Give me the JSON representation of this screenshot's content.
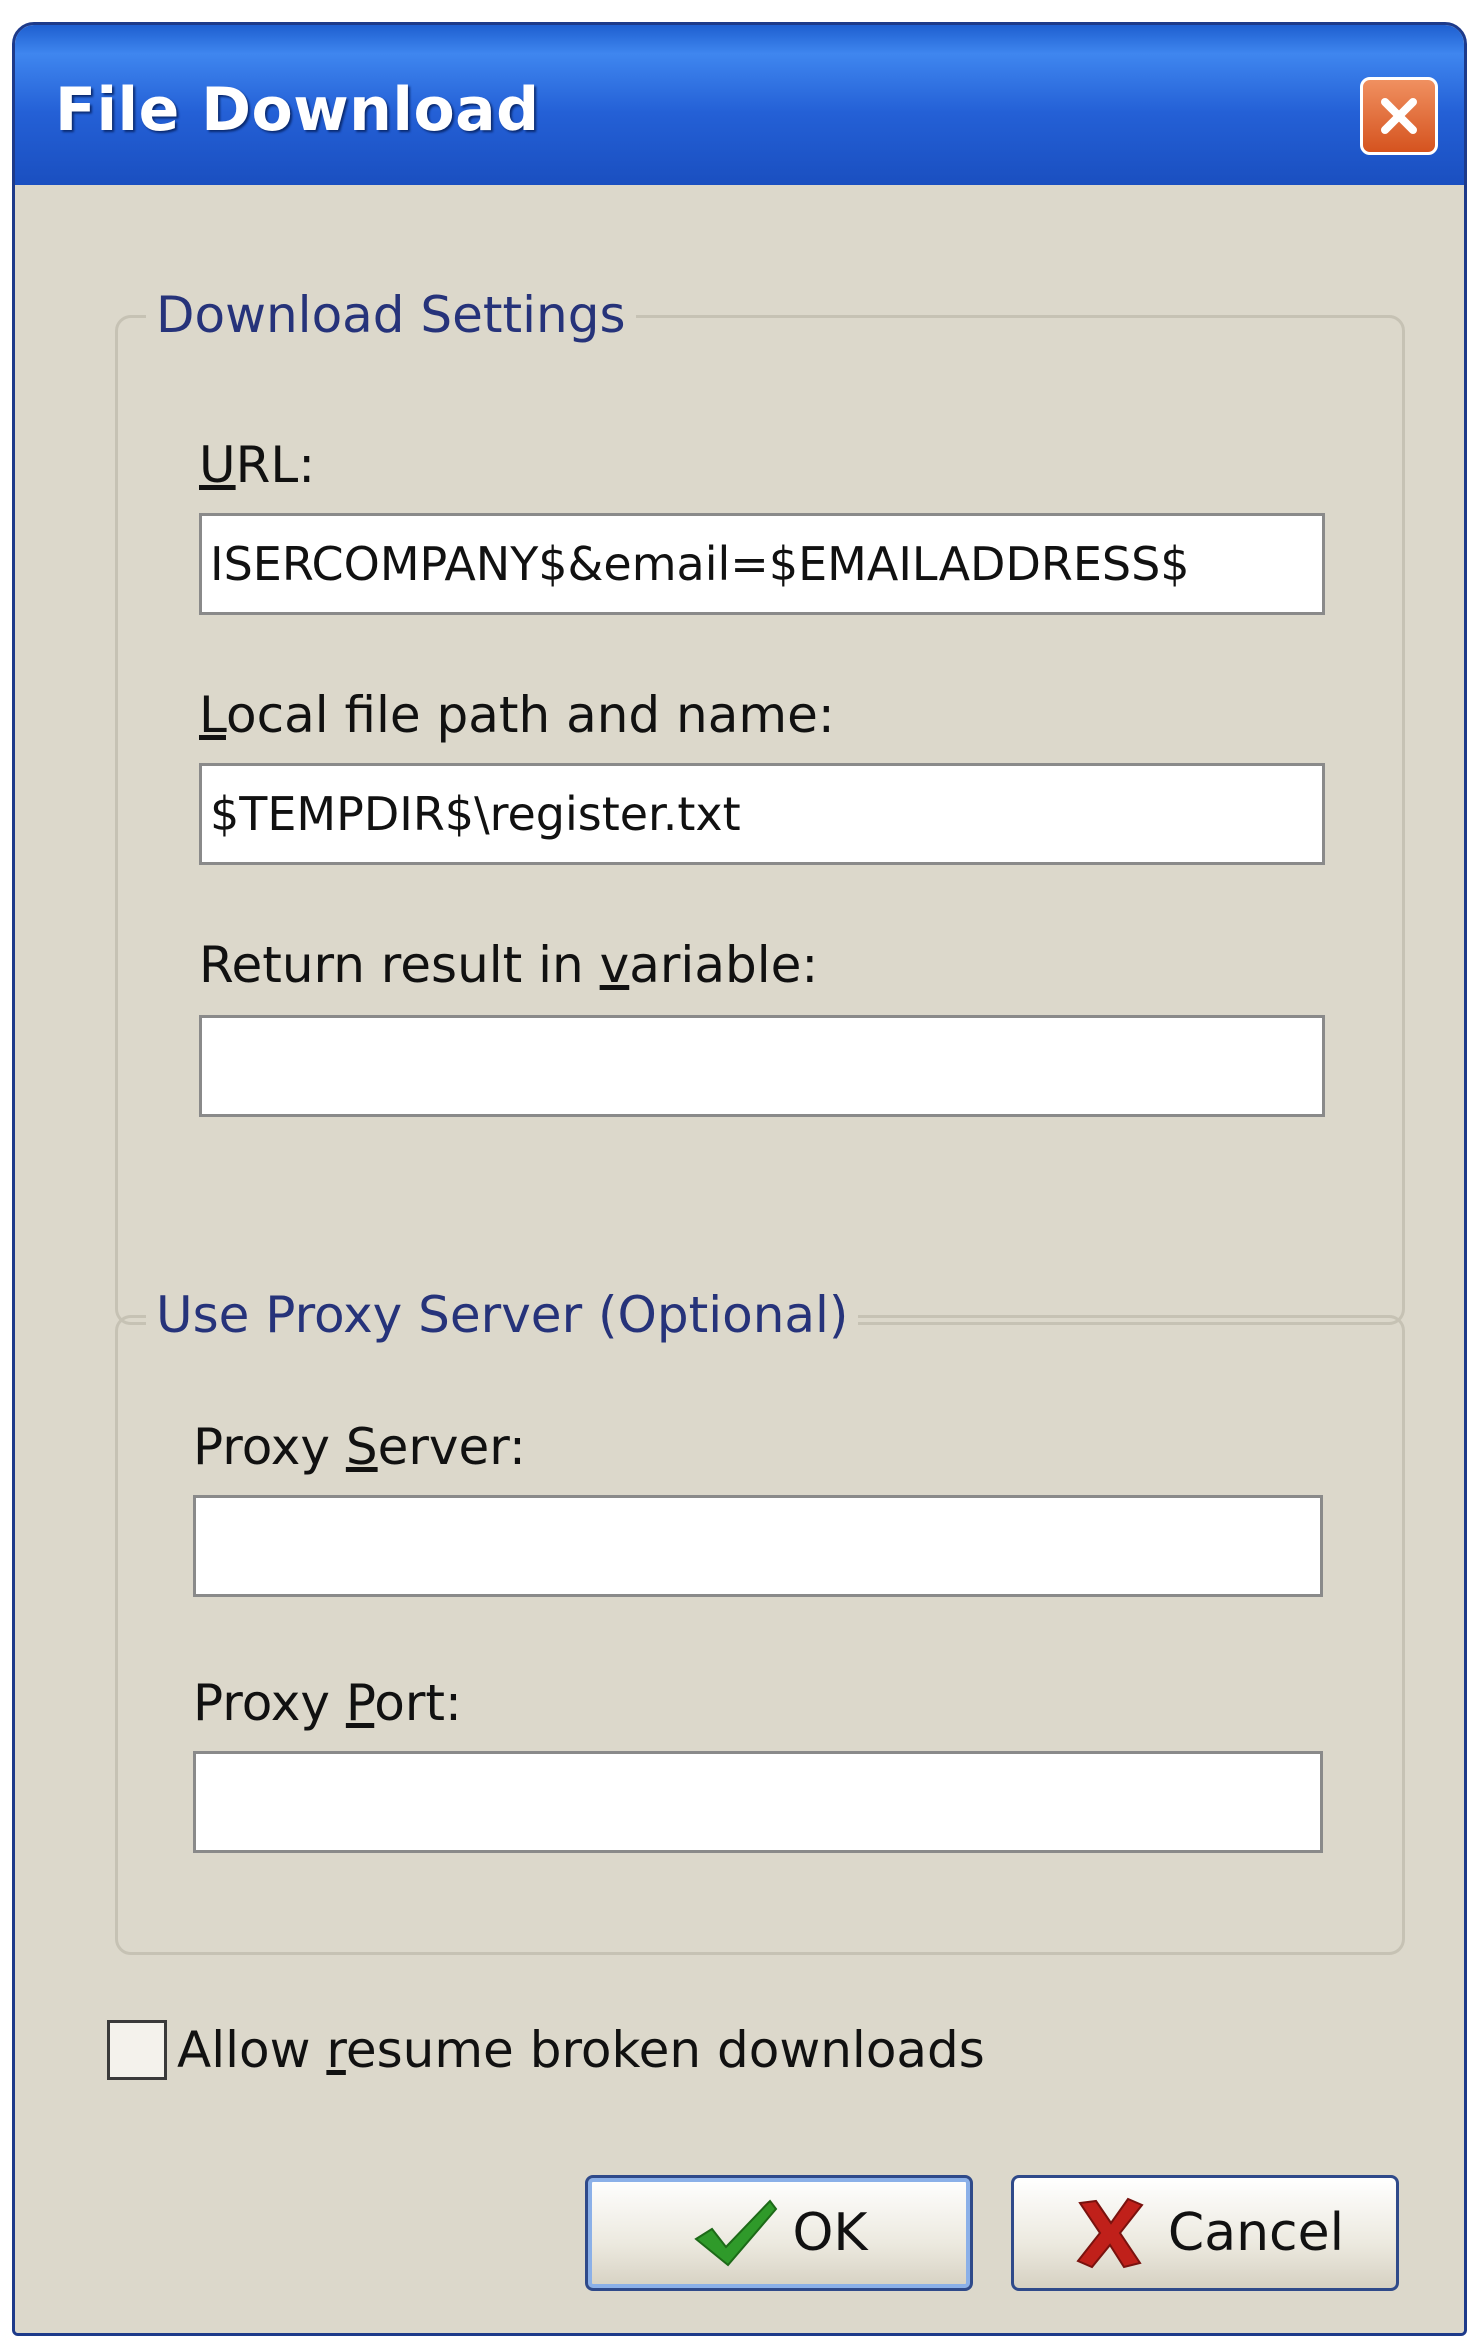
{
  "window": {
    "title": "File Download"
  },
  "download_settings": {
    "group_title": "Download Settings",
    "url_label_prefix": "",
    "url_label_accel": "U",
    "url_label_rest": "RL:",
    "url_value": "ISERCOMPANY$&email=$EMAILADDRESS$",
    "local_path_label_accel": "L",
    "local_path_label_rest": "ocal file path and name:",
    "local_path_value": "$TEMPDIR$\\register.txt",
    "return_var_label_prefix": "Return result in ",
    "return_var_label_accel": "v",
    "return_var_label_rest": "ariable:",
    "return_var_value": ""
  },
  "proxy": {
    "group_title": "Use Proxy Server (Optional)",
    "server_label_prefix": "Proxy ",
    "server_label_accel": "S",
    "server_label_rest": "erver:",
    "server_value": "",
    "port_label_prefix": "Proxy ",
    "port_label_accel": "P",
    "port_label_rest": "ort:",
    "port_value": ""
  },
  "options": {
    "resume_label_prefix": "Allow ",
    "resume_label_accel": "r",
    "resume_label_rest": "esume broken downloads",
    "resume_checked": false
  },
  "buttons": {
    "ok_label": "OK",
    "cancel_label": "Cancel"
  },
  "icons": {
    "close": "close-icon",
    "ok": "checkmark-icon",
    "cancel": "red-x-icon"
  },
  "colors": {
    "titlebar": "#2460d6",
    "close_button": "#d5531f",
    "group_title": "#26337a",
    "ok_check": "#2f9a2a",
    "cancel_x": "#c0201a"
  }
}
